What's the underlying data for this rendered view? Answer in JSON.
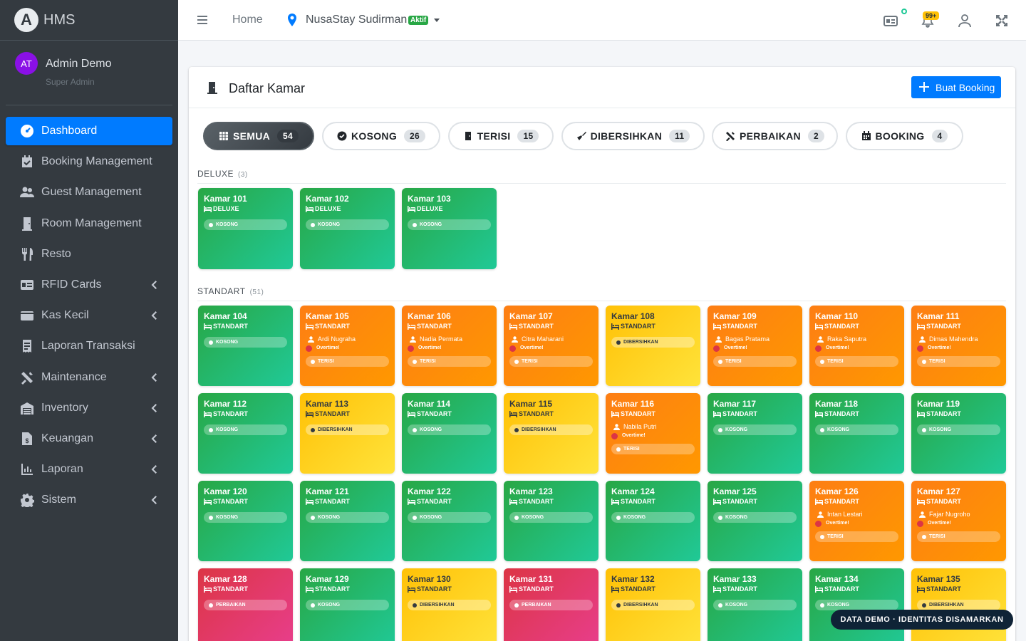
{
  "brand": {
    "logo_letter": "A",
    "name": "HMS"
  },
  "user": {
    "initials": "AT",
    "name": "Admin Demo",
    "role": "Super Admin"
  },
  "sidebar": {
    "items": [
      {
        "label": "Dashboard",
        "icon": "tachometer-icon"
      },
      {
        "label": "Booking Management",
        "icon": "calendar-check-icon"
      },
      {
        "label": "Guest Management",
        "icon": "users-icon"
      },
      {
        "label": "Room Management",
        "icon": "door-icon"
      },
      {
        "label": "Resto",
        "icon": "utensils-icon"
      },
      {
        "label": "RFID Cards",
        "icon": "id-card-icon"
      },
      {
        "label": "Kas Kecil",
        "icon": "wallet-icon"
      },
      {
        "label": "Laporan Transaksi",
        "icon": "receipt-icon"
      },
      {
        "label": "Maintenance",
        "icon": "tools-icon"
      },
      {
        "label": "Inventory",
        "icon": "warehouse-icon"
      },
      {
        "label": "Keuangan",
        "icon": "file-invoice-icon"
      },
      {
        "label": "Laporan",
        "icon": "chart-line-icon"
      },
      {
        "label": "Sistem",
        "icon": "cog-icon"
      }
    ]
  },
  "topbar": {
    "home": "Home",
    "hotel": "NusaStay Sudirman",
    "hotel_status": "Aktif",
    "notif_count": "99+"
  },
  "card": {
    "title": "Daftar Kamar",
    "button": "Buat Booking"
  },
  "filters": [
    {
      "label": "SEMUA",
      "count": "54"
    },
    {
      "label": "KOSONG",
      "count": "26"
    },
    {
      "label": "TERISI",
      "count": "15"
    },
    {
      "label": "DIBERSIHKAN",
      "count": "11"
    },
    {
      "label": "PERBAIKAN",
      "count": "2"
    },
    {
      "label": "BOOKING",
      "count": "4"
    }
  ],
  "sections": [
    {
      "name": "DELUXE",
      "count": "(3)"
    },
    {
      "name": "STANDART",
      "count": "(51)"
    }
  ],
  "overtime_text": "Overtime!",
  "rooms": [
    {
      "name": "Kamar 101",
      "type": "DELUXE",
      "status": "KOSONG",
      "color": "green"
    },
    {
      "name": "Kamar 102",
      "type": "DELUXE",
      "status": "KOSONG",
      "color": "green"
    },
    {
      "name": "Kamar 103",
      "type": "DELUXE",
      "status": "KOSONG",
      "color": "green"
    },
    {
      "name": "Kamar 104",
      "type": "STANDART",
      "status": "KOSONG",
      "color": "green"
    },
    {
      "name": "Kamar 105",
      "type": "STANDART",
      "status": "TERISI",
      "color": "orange",
      "guest": "Ardi Nugraha"
    },
    {
      "name": "Kamar 106",
      "type": "STANDART",
      "status": "TERISI",
      "color": "orange",
      "guest": "Nadia Permata"
    },
    {
      "name": "Kamar 107",
      "type": "STANDART",
      "status": "TERISI",
      "color": "orange",
      "guest": "Citra Maharani"
    },
    {
      "name": "Kamar 108",
      "type": "STANDART",
      "status": "DIBERSIHKAN",
      "color": "yellow"
    },
    {
      "name": "Kamar 109",
      "type": "STANDART",
      "status": "TERISI",
      "color": "orange",
      "guest": "Bagas Pratama"
    },
    {
      "name": "Kamar 110",
      "type": "STANDART",
      "status": "TERISI",
      "color": "orange",
      "guest": "Raka Saputra"
    },
    {
      "name": "Kamar 111",
      "type": "STANDART",
      "status": "TERISI",
      "color": "orange",
      "guest": "Dimas Mahendra"
    },
    {
      "name": "Kamar 112",
      "type": "STANDART",
      "status": "KOSONG",
      "color": "green"
    },
    {
      "name": "Kamar 113",
      "type": "STANDART",
      "status": "DIBERSIHKAN",
      "color": "yellow"
    },
    {
      "name": "Kamar 114",
      "type": "STANDART",
      "status": "KOSONG",
      "color": "green"
    },
    {
      "name": "Kamar 115",
      "type": "STANDART",
      "status": "DIBERSIHKAN",
      "color": "yellow"
    },
    {
      "name": "Kamar 116",
      "type": "STANDART",
      "status": "TERISI",
      "color": "orange",
      "guest": "Nabila Putri"
    },
    {
      "name": "Kamar 117",
      "type": "STANDART",
      "status": "KOSONG",
      "color": "green"
    },
    {
      "name": "Kamar 118",
      "type": "STANDART",
      "status": "KOSONG",
      "color": "green"
    },
    {
      "name": "Kamar 119",
      "type": "STANDART",
      "status": "KOSONG",
      "color": "green"
    },
    {
      "name": "Kamar 120",
      "type": "STANDART",
      "status": "KOSONG",
      "color": "green"
    },
    {
      "name": "Kamar 121",
      "type": "STANDART",
      "status": "KOSONG",
      "color": "green"
    },
    {
      "name": "Kamar 122",
      "type": "STANDART",
      "status": "KOSONG",
      "color": "green"
    },
    {
      "name": "Kamar 123",
      "type": "STANDART",
      "status": "KOSONG",
      "color": "green"
    },
    {
      "name": "Kamar 124",
      "type": "STANDART",
      "status": "KOSONG",
      "color": "green"
    },
    {
      "name": "Kamar 125",
      "type": "STANDART",
      "status": "KOSONG",
      "color": "green"
    },
    {
      "name": "Kamar 126",
      "type": "STANDART",
      "status": "TERISI",
      "color": "orange",
      "guest": "Intan Lestari"
    },
    {
      "name": "Kamar 127",
      "type": "STANDART",
      "status": "TERISI",
      "color": "orange",
      "guest": "Fajar Nugroho"
    },
    {
      "name": "Kamar 128",
      "type": "STANDART",
      "status": "PERBAIKAN",
      "color": "red"
    },
    {
      "name": "Kamar 129",
      "type": "STANDART",
      "status": "KOSONG",
      "color": "green"
    },
    {
      "name": "Kamar 130",
      "type": "STANDART",
      "status": "DIBERSIHKAN",
      "color": "yellow"
    },
    {
      "name": "Kamar 131",
      "type": "STANDART",
      "status": "PERBAIKAN",
      "color": "red"
    },
    {
      "name": "Kamar 132",
      "type": "STANDART",
      "status": "DIBERSIHKAN",
      "color": "yellow"
    },
    {
      "name": "Kamar 133",
      "type": "STANDART",
      "status": "KOSONG",
      "color": "green"
    },
    {
      "name": "Kamar 134",
      "type": "STANDART",
      "status": "KOSONG",
      "color": "green"
    },
    {
      "name": "Kamar 135",
      "type": "STANDART",
      "status": "DIBERSIHKAN",
      "color": "yellow"
    }
  ],
  "demo_badge": "DATA DEMO · IDENTITAS DISAMARKAN"
}
